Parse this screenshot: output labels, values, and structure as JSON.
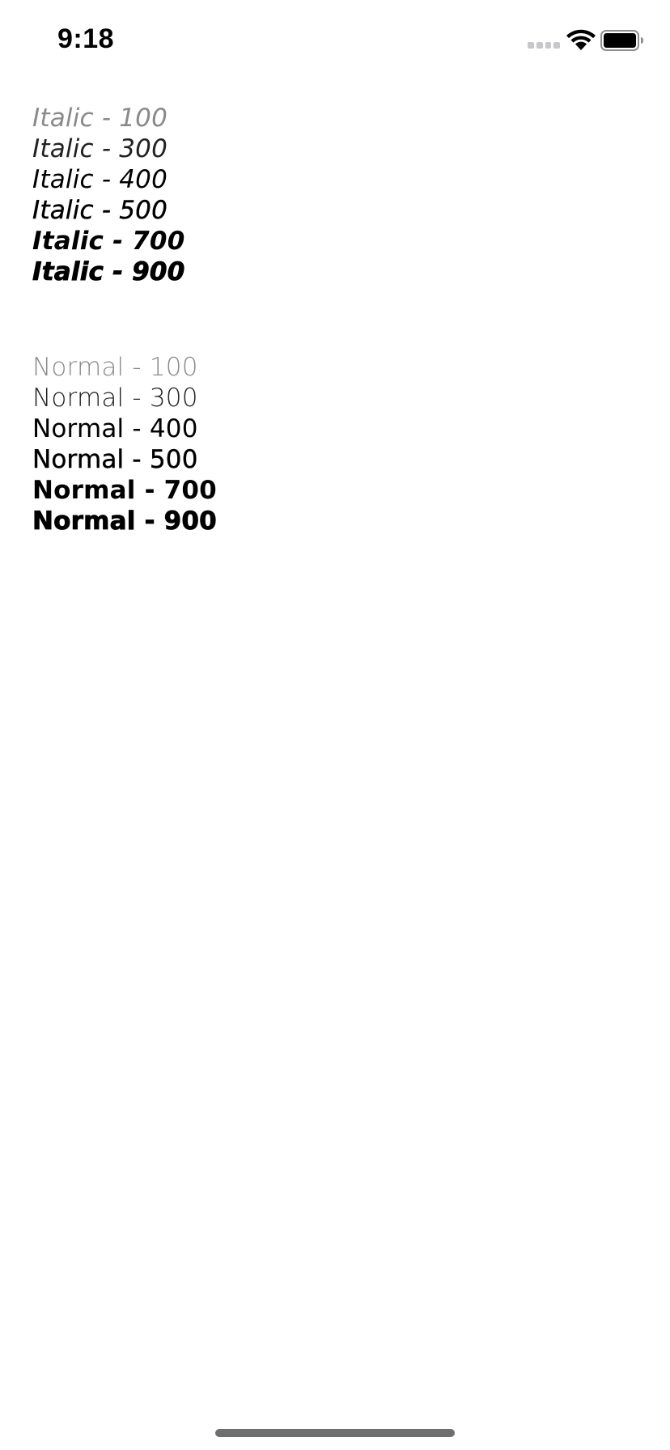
{
  "status_bar": {
    "time": "9:18",
    "icons": [
      "cellular-signal-icon",
      "wifi-icon",
      "battery-icon"
    ],
    "battery_level": 1.0
  },
  "italic_samples": [
    {
      "label": "Italic - 100"
    },
    {
      "label": "Italic - 300"
    },
    {
      "label": "Italic - 400"
    },
    {
      "label": "Italic - 500"
    },
    {
      "label": "Italic - 700"
    },
    {
      "label": "Italic - 900"
    }
  ],
  "normal_samples": [
    {
      "label": "Normal - 100"
    },
    {
      "label": "Normal - 300"
    },
    {
      "label": "Normal - 400"
    },
    {
      "label": "Normal - 500"
    },
    {
      "label": "Normal - 700"
    },
    {
      "label": "Normal - 900"
    }
  ],
  "colors": {
    "background": "#ffffff",
    "text": "#000000",
    "light_text": "#8a8a8a",
    "home_indicator": "#6e6e6e"
  }
}
